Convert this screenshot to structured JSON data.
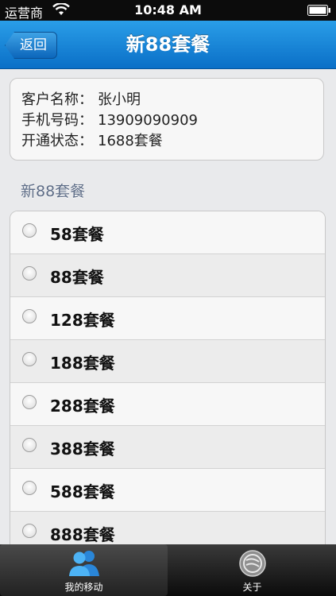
{
  "status": {
    "carrier": "运营商",
    "time": "10:48 AM"
  },
  "nav": {
    "back": "返回",
    "title": "新88套餐"
  },
  "customer": {
    "name_label": "客户名称：",
    "name": "张小明",
    "phone_label": "手机号码：",
    "phone": "13909090909",
    "status_label": "开通状态：",
    "status": "1688套餐"
  },
  "section_title": "新88套餐",
  "plans": [
    "58套餐",
    "88套餐",
    "128套餐",
    "188套餐",
    "288套餐",
    "388套餐",
    "588套餐",
    "888套餐"
  ],
  "tabs": [
    {
      "label": "我的移动",
      "icon": "users-icon",
      "selected": true
    },
    {
      "label": "关于",
      "icon": "china-mobile-logo-icon",
      "selected": false
    }
  ],
  "colors": {
    "nav_blue": "#0a6fc7",
    "section_text": "#5d6c86",
    "tab_icon_blue": "#3aa0f0"
  }
}
